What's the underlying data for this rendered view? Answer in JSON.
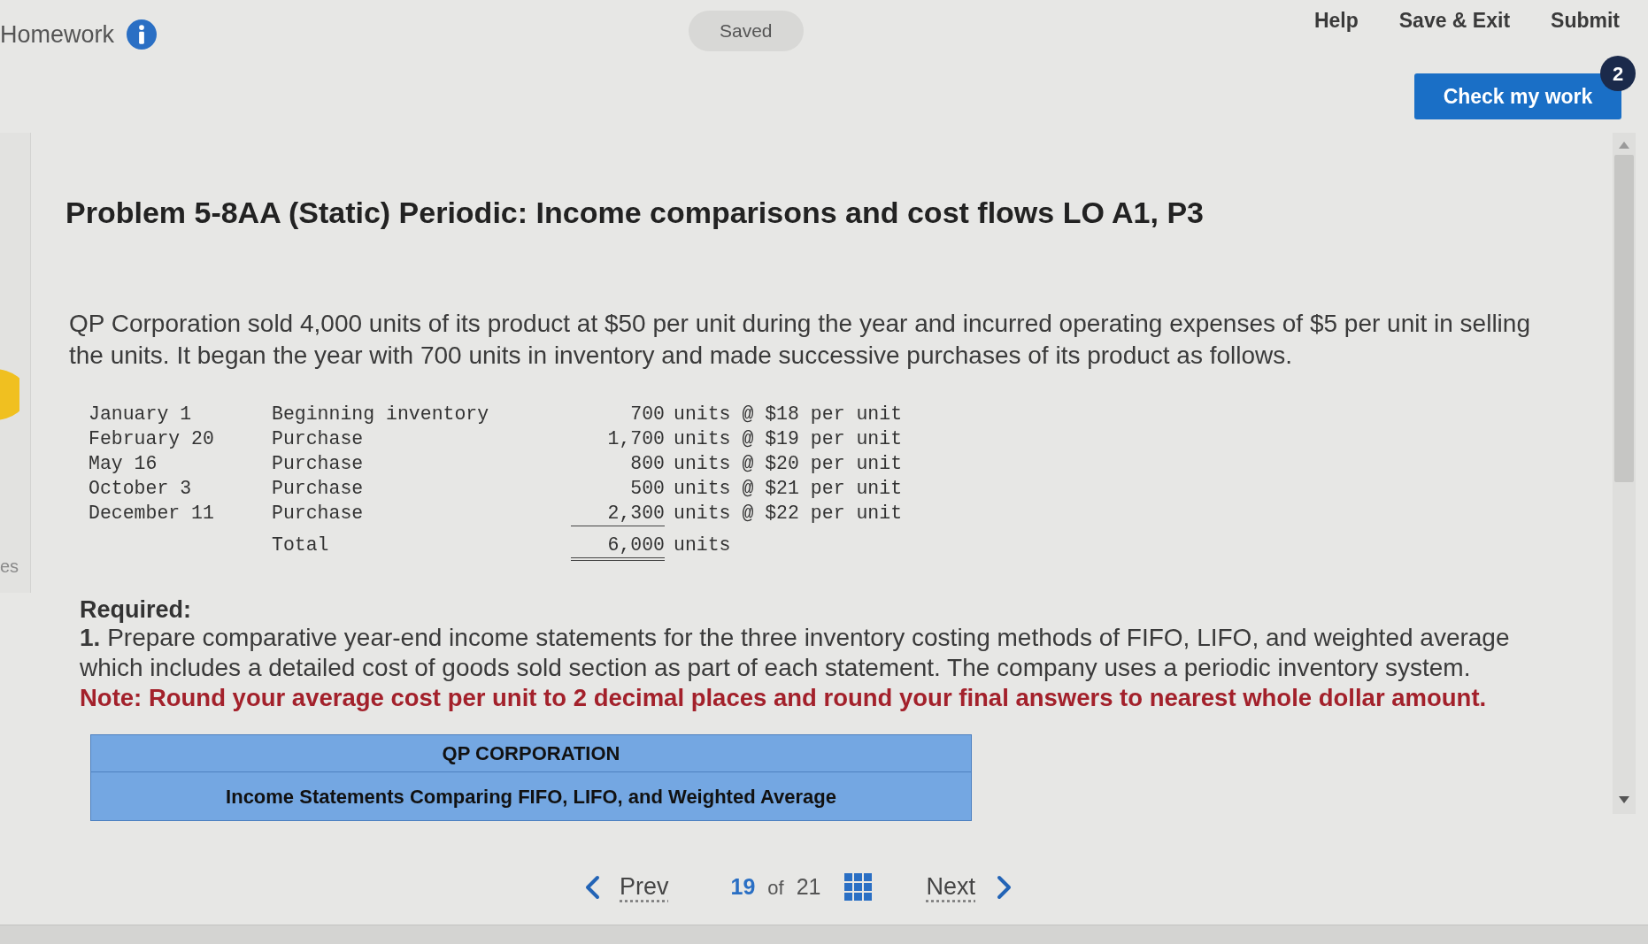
{
  "header": {
    "title": "Homework",
    "status": "Saved",
    "links": [
      "Help",
      "Save & Exit",
      "Submit"
    ]
  },
  "check_work": {
    "label": "Check my work",
    "badge": "2"
  },
  "side_panel": {
    "text": "es"
  },
  "problem": {
    "title": "Problem 5-8AA (Static) Periodic: Income comparisons and cost flows LO A1, P3",
    "intro": "QP Corporation sold 4,000 units of its product at $50 per unit during the year and incurred operating expenses of $5 per unit in selling the units. It began the year with 700 units in inventory and made successive purchases of its product as follows.",
    "purchases": [
      {
        "date": "January 1",
        "description": "Beginning inventory",
        "units": "700",
        "detail": "units @ $18 per unit"
      },
      {
        "date": "February 20",
        "description": "Purchase",
        "units": "1,700",
        "detail": "units @ $19 per unit"
      },
      {
        "date": "May 16",
        "description": "Purchase",
        "units": "800",
        "detail": "units @ $20 per unit"
      },
      {
        "date": "October 3",
        "description": "Purchase",
        "units": "500",
        "detail": "units @ $21 per unit"
      },
      {
        "date": "December 11",
        "description": "Purchase",
        "units": "2,300",
        "detail": "units @ $22 per unit"
      }
    ],
    "total": {
      "label": "Total",
      "units": "6,000",
      "detail": "units"
    }
  },
  "required": {
    "heading": "Required:",
    "items": [
      {
        "text": "**1.** Prepare comparative year-end income statements for the three inventory costing methods of FIFO, LIFO, and weighted average which includes a detailed cost of goods sold section as part of each statement. The company uses a periodic inventory system."
      }
    ],
    "note": "Note: Round your average cost per unit to 2 decimal places and round your final answers to nearest whole dollar amount."
  },
  "statement": {
    "company": "QP CORPORATION",
    "title": "Income Statements Comparing FIFO, LIFO, and Weighted Average"
  },
  "pagination": {
    "prev": "Prev",
    "current": "19",
    "of": "of",
    "total": "21",
    "next": "Next"
  }
}
